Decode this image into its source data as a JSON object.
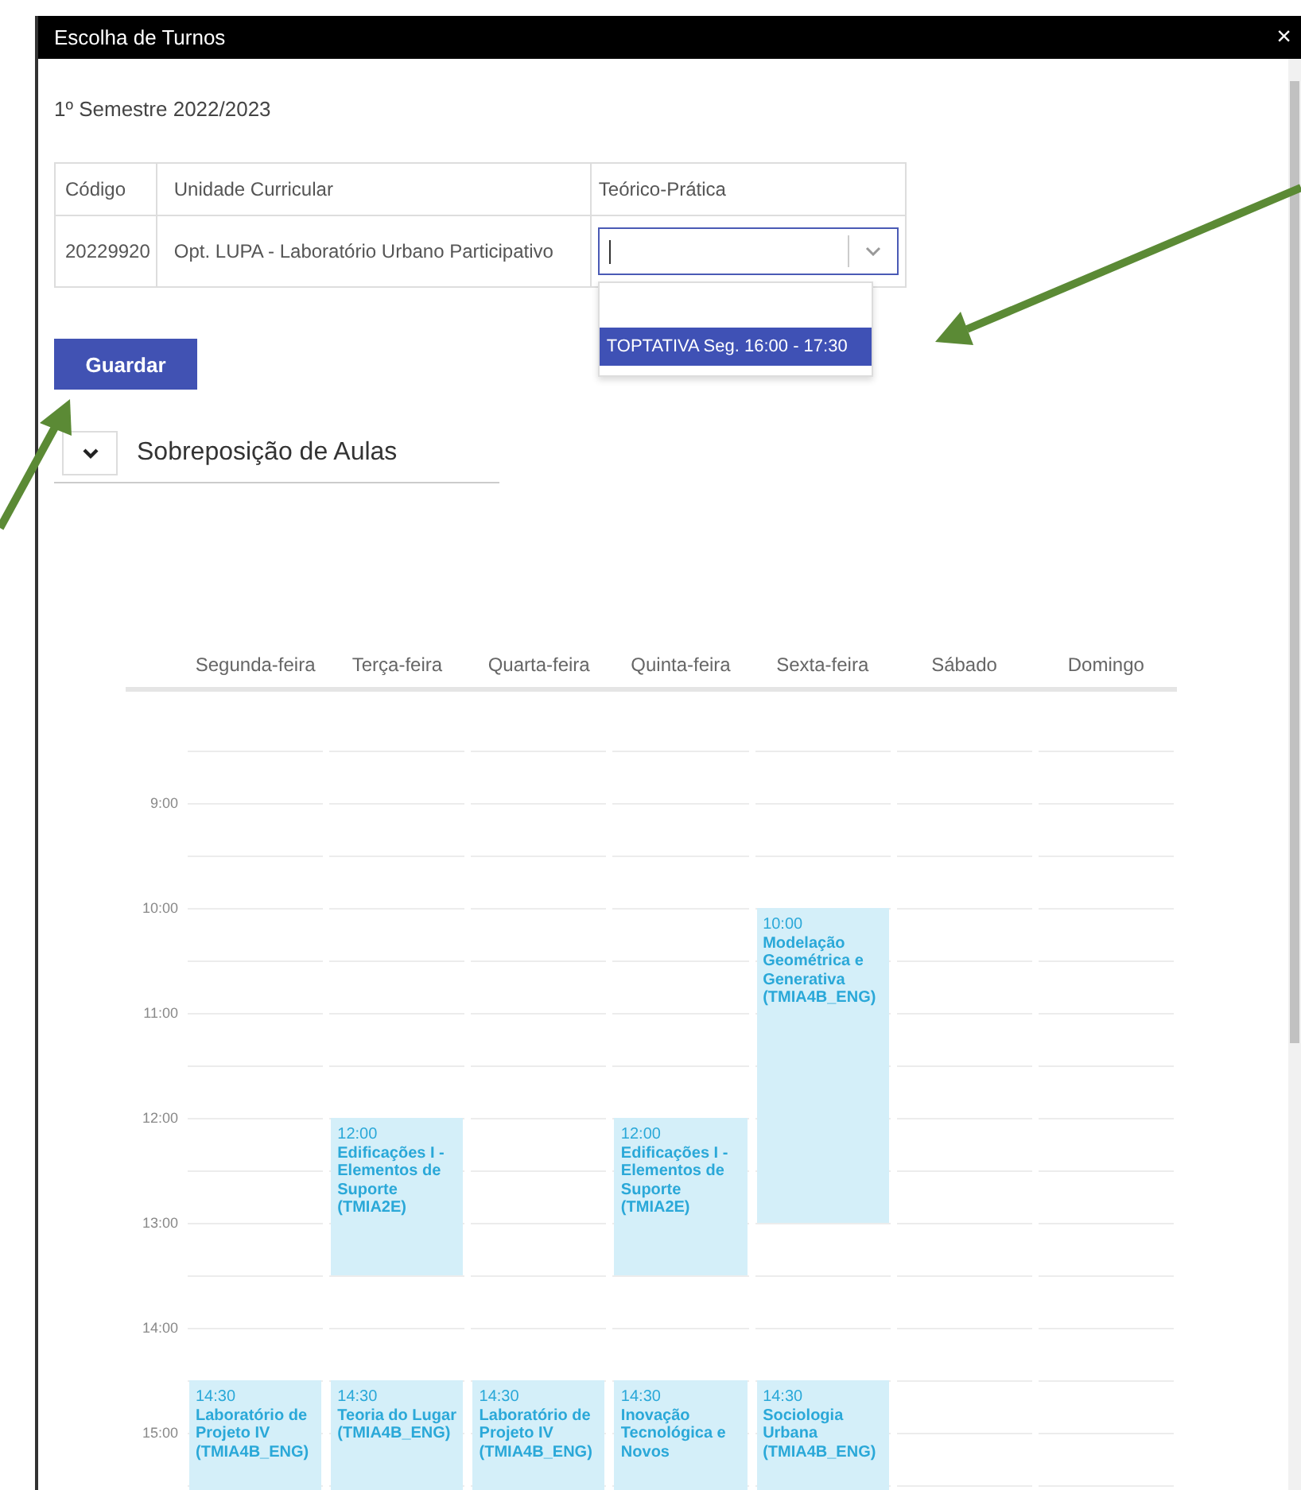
{
  "window": {
    "title": "Escolha de Turnos",
    "close": "×"
  },
  "semester": "1º Semestre 2022/2023",
  "table": {
    "columns": [
      "Código",
      "Unidade Curricular",
      "Teórico-Prática"
    ],
    "rows": [
      {
        "code": "20229920",
        "unit": "Opt. LUPA - Laboratório Urbano Participativo",
        "select": {
          "expanded": true,
          "options": [
            {
              "label": "TOPTATIVA Seg. 16:00 - 17:30",
              "selected": true
            }
          ]
        }
      }
    ]
  },
  "save_button": "Guardar",
  "section": {
    "title": "Sobreposição de Aulas"
  },
  "calendar": {
    "times": [
      "9:00",
      "10:00",
      "11:00",
      "12:00",
      "13:00",
      "14:00",
      "15:00"
    ],
    "days": [
      {
        "label": "Segunda-feira",
        "events": [
          {
            "time": "14:30",
            "kind": "open",
            "title": "Laboratório de Projeto IV (TMIA4B_ENG)"
          }
        ]
      },
      {
        "label": "Terça-feira",
        "events": [
          {
            "time": "12:00",
            "kind": "medium",
            "title": "Edificações I - Elementos de Suporte (TMIA2E)"
          },
          {
            "time": "14:30",
            "kind": "open",
            "title": "Teoria do Lugar (TMIA4B_ENG)"
          }
        ]
      },
      {
        "label": "Quarta-feira",
        "events": [
          {
            "time": "14:30",
            "kind": "open",
            "title": "Laboratório de Projeto IV (TMIA4B_ENG)"
          }
        ]
      },
      {
        "label": "Quinta-feira",
        "events": [
          {
            "time": "12:00",
            "kind": "medium",
            "title": "Edificações I - Elementos de Suporte (TMIA2E)"
          },
          {
            "time": "14:30",
            "kind": "open",
            "title": "Inovação Tecnológica e Novos"
          }
        ]
      },
      {
        "label": "Sexta-feira",
        "events": [
          {
            "time": "10:00",
            "kind": "long",
            "title": "Modelação Geométrica e Generativa (TMIA4B_ENG)"
          },
          {
            "time": "14:30",
            "kind": "open",
            "title": "Sociologia Urbana (TMIA4B_ENG)"
          }
        ]
      },
      {
        "label": "Sábado"
      },
      {
        "label": "Domingo"
      }
    ]
  }
}
